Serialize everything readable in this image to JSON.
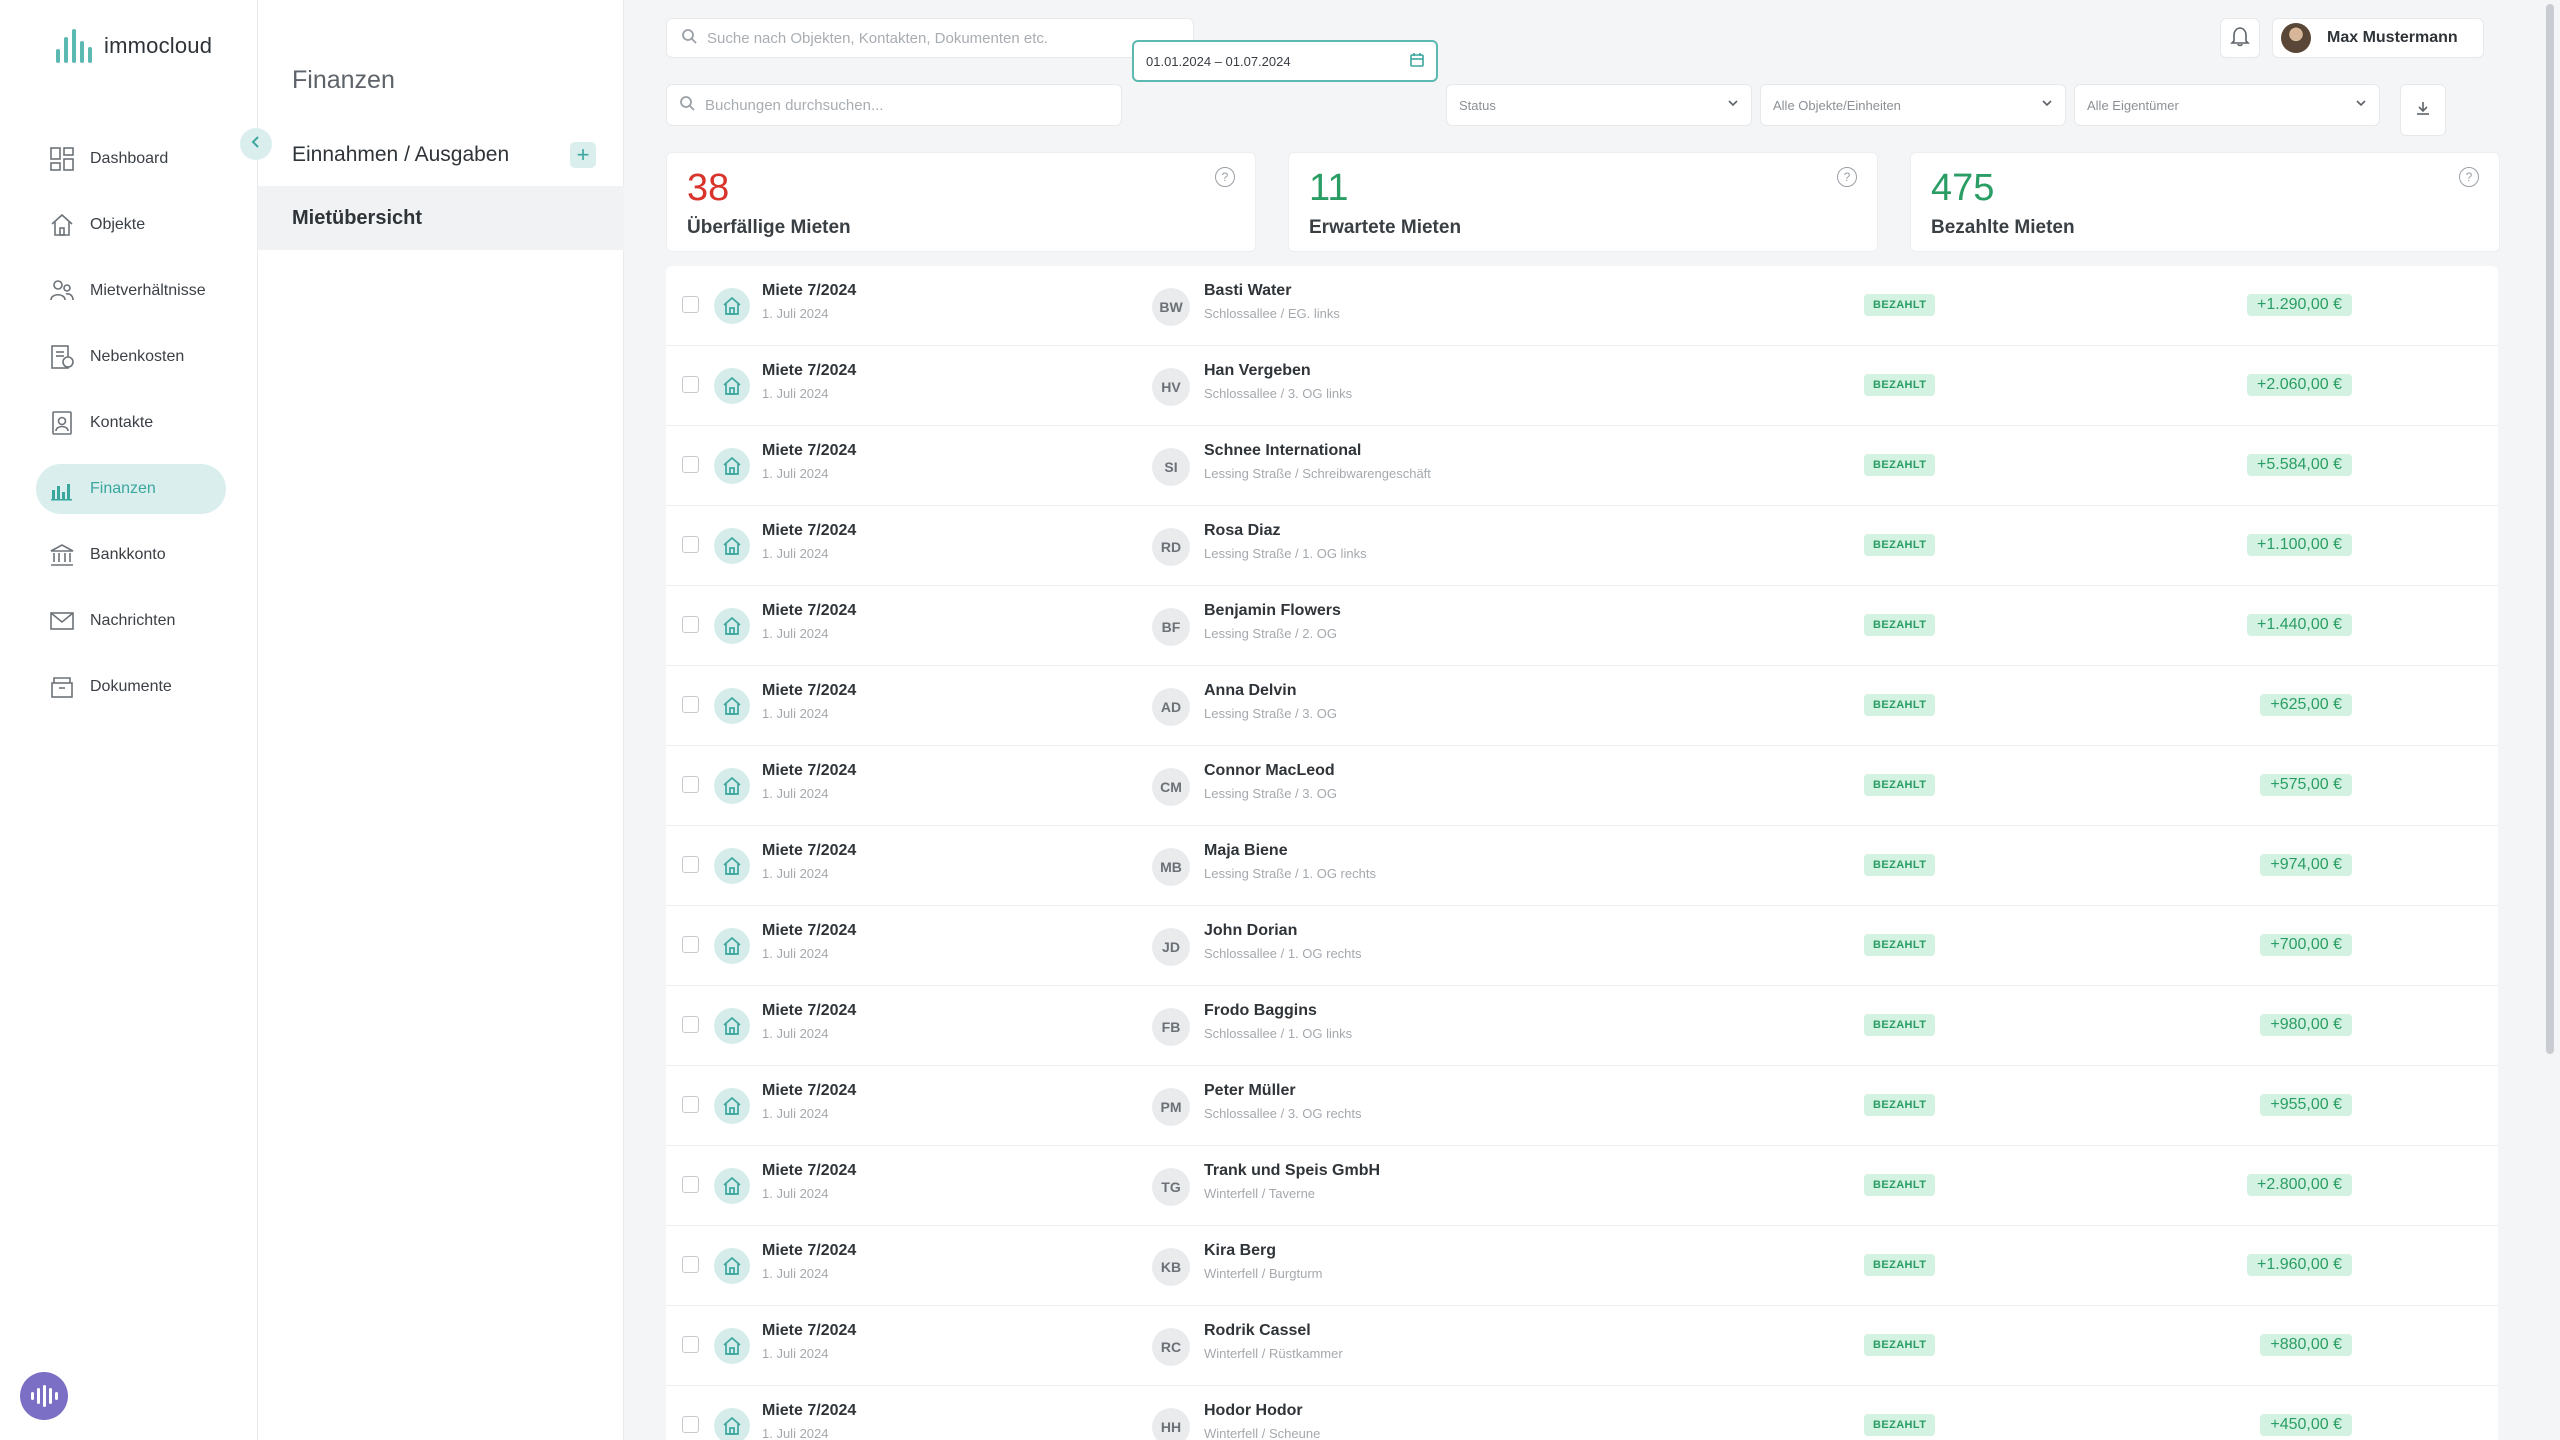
{
  "brand": {
    "name": "immocloud",
    "accent": "#5bb9b0"
  },
  "nav": {
    "items": [
      {
        "label": "Dashboard",
        "icon": "dashboard-icon",
        "active": false
      },
      {
        "label": "Objekte",
        "icon": "home-icon",
        "active": false
      },
      {
        "label": "Mietverhältnisse",
        "icon": "people-icon",
        "active": false
      },
      {
        "label": "Nebenkosten",
        "icon": "bill-icon",
        "active": false
      },
      {
        "label": "Kontakte",
        "icon": "contact-card-icon",
        "active": false
      },
      {
        "label": "Finanzen",
        "icon": "bar-chart-icon",
        "active": true
      },
      {
        "label": "Bankkonto",
        "icon": "bank-icon",
        "active": false
      },
      {
        "label": "Nachrichten",
        "icon": "mail-icon",
        "active": false
      },
      {
        "label": "Dokumente",
        "icon": "archive-box-icon",
        "active": false
      }
    ]
  },
  "subpanel": {
    "title": "Finanzen",
    "section_label": "Einnahmen / Ausgaben",
    "selected_item": "Mietübersicht"
  },
  "topbar": {
    "search_placeholder": "Suche nach Objekten, Kontakten, Dokumenten etc.",
    "user_name": "Max Mustermann"
  },
  "filters": {
    "booking_search_placeholder": "Buchungen durchsuchen...",
    "date_range": "01.01.2024 – 01.07.2024",
    "status": "Status",
    "objects": "Alle Objekte/Einheiten",
    "owners": "Alle Eigentümer"
  },
  "stats": [
    {
      "value": "38",
      "label": "Überfällige Mieten",
      "color": "#d9342b"
    },
    {
      "value": "11",
      "label": "Erwartete Mieten",
      "color": "#2a9d64"
    },
    {
      "value": "475",
      "label": "Bezahlte Mieten",
      "color": "#2a9d64"
    }
  ],
  "rows": [
    {
      "title": "Miete 7/2024",
      "date": "1. Juli 2024",
      "initials": "BW",
      "tenant": "Basti Water",
      "unit": "Schlossallee / EG. links",
      "status": "BEZAHLT",
      "amount": "+1.290,00 €"
    },
    {
      "title": "Miete 7/2024",
      "date": "1. Juli 2024",
      "initials": "HV",
      "tenant": "Han Vergeben",
      "unit": "Schlossallee / 3. OG links",
      "status": "BEZAHLT",
      "amount": "+2.060,00 €"
    },
    {
      "title": "Miete 7/2024",
      "date": "1. Juli 2024",
      "initials": "SI",
      "tenant": "Schnee International",
      "unit": "Lessing Straße / Schreibwarengeschäft",
      "status": "BEZAHLT",
      "amount": "+5.584,00 €"
    },
    {
      "title": "Miete 7/2024",
      "date": "1. Juli 2024",
      "initials": "RD",
      "tenant": "Rosa Diaz",
      "unit": "Lessing Straße / 1. OG links",
      "status": "BEZAHLT",
      "amount": "+1.100,00 €"
    },
    {
      "title": "Miete 7/2024",
      "date": "1. Juli 2024",
      "initials": "BF",
      "tenant": "Benjamin Flowers",
      "unit": "Lessing Straße / 2. OG",
      "status": "BEZAHLT",
      "amount": "+1.440,00 €"
    },
    {
      "title": "Miete 7/2024",
      "date": "1. Juli 2024",
      "initials": "AD",
      "tenant": "Anna Delvin",
      "unit": "Lessing Straße / 3. OG",
      "status": "BEZAHLT",
      "amount": "+625,00 €"
    },
    {
      "title": "Miete 7/2024",
      "date": "1. Juli 2024",
      "initials": "CM",
      "tenant": "Connor MacLeod",
      "unit": "Lessing Straße / 3. OG",
      "status": "BEZAHLT",
      "amount": "+575,00 €"
    },
    {
      "title": "Miete 7/2024",
      "date": "1. Juli 2024",
      "initials": "MB",
      "tenant": "Maja Biene",
      "unit": "Lessing Straße / 1. OG rechts",
      "status": "BEZAHLT",
      "amount": "+974,00 €"
    },
    {
      "title": "Miete 7/2024",
      "date": "1. Juli 2024",
      "initials": "JD",
      "tenant": "John Dorian",
      "unit": "Schlossallee / 1. OG rechts",
      "status": "BEZAHLT",
      "amount": "+700,00 €"
    },
    {
      "title": "Miete 7/2024",
      "date": "1. Juli 2024",
      "initials": "FB",
      "tenant": "Frodo Baggins",
      "unit": "Schlossallee / 1. OG links",
      "status": "BEZAHLT",
      "amount": "+980,00 €"
    },
    {
      "title": "Miete 7/2024",
      "date": "1. Juli 2024",
      "initials": "PM",
      "tenant": "Peter Müller",
      "unit": "Schlossallee / 3. OG rechts",
      "status": "BEZAHLT",
      "amount": "+955,00 €"
    },
    {
      "title": "Miete 7/2024",
      "date": "1. Juli 2024",
      "initials": "TG",
      "tenant": "Trank und Speis GmbH",
      "unit": "Winterfell / Taverne",
      "status": "BEZAHLT",
      "amount": "+2.800,00 €"
    },
    {
      "title": "Miete 7/2024",
      "date": "1. Juli 2024",
      "initials": "KB",
      "tenant": "Kira Berg",
      "unit": "Winterfell / Burgturm",
      "status": "BEZAHLT",
      "amount": "+1.960,00 €"
    },
    {
      "title": "Miete 7/2024",
      "date": "1. Juli 2024",
      "initials": "RC",
      "tenant": "Rodrik Cassel",
      "unit": "Winterfell / Rüstkammer",
      "status": "BEZAHLT",
      "amount": "+880,00 €"
    },
    {
      "title": "Miete 7/2024",
      "date": "1. Juli 2024",
      "initials": "HH",
      "tenant": "Hodor Hodor",
      "unit": "Winterfell / Scheune",
      "status": "BEZAHLT",
      "amount": "+450,00 €"
    }
  ]
}
